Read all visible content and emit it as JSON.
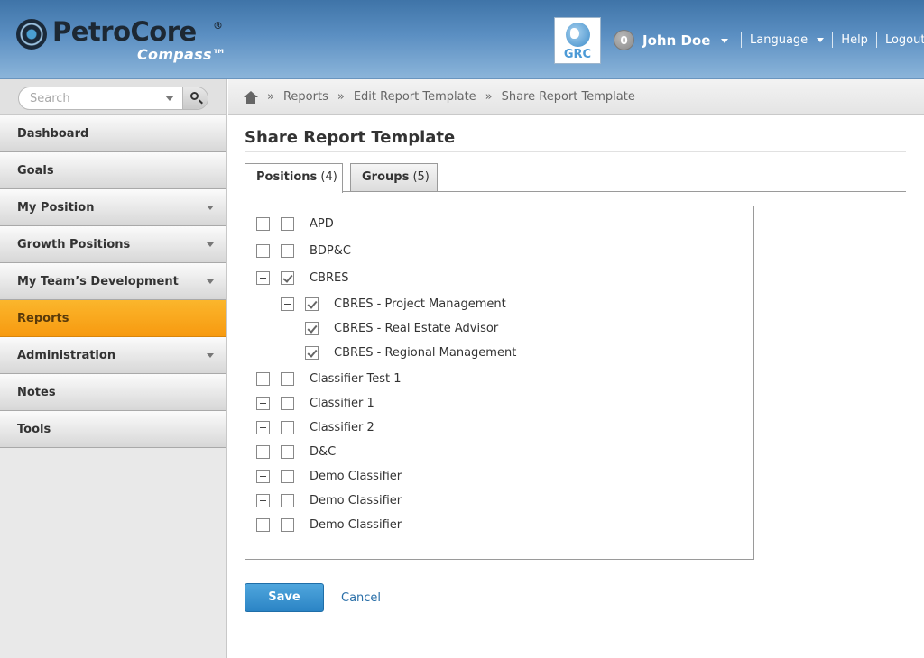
{
  "header": {
    "logo_name": "PetroCore",
    "logo_reg": "®",
    "logo_sub": "Compass™",
    "badge_label": "GRC",
    "notification_count": "0",
    "user_name": "John Doe",
    "language_label": "Language",
    "help_label": "Help",
    "logout_label": "Logout"
  },
  "sidebar": {
    "search_placeholder": "Search",
    "items": [
      {
        "label": "Dashboard",
        "has_caret": false
      },
      {
        "label": "Goals",
        "has_caret": false
      },
      {
        "label": "My Position",
        "has_caret": true
      },
      {
        "label": "Growth Positions",
        "has_caret": true
      },
      {
        "label": "My Team’s Development",
        "has_caret": true
      },
      {
        "label": "Reports",
        "has_caret": false,
        "active": true
      },
      {
        "label": "Administration",
        "has_caret": true
      },
      {
        "label": "Notes",
        "has_caret": false
      },
      {
        "label": "Tools",
        "has_caret": false
      }
    ]
  },
  "breadcrumb": {
    "items": [
      "Reports",
      "Edit Report Template",
      "Share Report Template"
    ],
    "separator": "»"
  },
  "main": {
    "title": "Share Report Template",
    "tabs": [
      {
        "label": "Positions",
        "count": "(4)",
        "active": true
      },
      {
        "label": "Groups",
        "count": "(5)",
        "active": false
      }
    ],
    "tree": [
      {
        "label": "APD",
        "expander": "plus",
        "checked": false,
        "level": 0
      },
      {
        "label": "BDP&C",
        "expander": "plus",
        "checked": false,
        "level": 0
      },
      {
        "label": "CBRES",
        "expander": "minus",
        "checked": true,
        "level": 0
      },
      {
        "label": "CBRES - Project Management",
        "expander": "minus",
        "checked": true,
        "level": 1
      },
      {
        "label": "CBRES - Real Estate Advisor",
        "expander": "none",
        "checked": true,
        "level": 1
      },
      {
        "label": "CBRES - Regional Management",
        "expander": "none",
        "checked": true,
        "level": 1
      },
      {
        "label": "Classifier Test 1",
        "expander": "plus",
        "checked": false,
        "level": 0
      },
      {
        "label": "Classifier 1",
        "expander": "plus",
        "checked": false,
        "level": 0
      },
      {
        "label": "Classifier 2",
        "expander": "plus",
        "checked": false,
        "level": 0
      },
      {
        "label": "D&C",
        "expander": "plus",
        "checked": false,
        "level": 0
      },
      {
        "label": "Demo Classifier",
        "expander": "plus",
        "checked": false,
        "level": 0
      },
      {
        "label": "Demo Classifier",
        "expander": "plus",
        "checked": false,
        "level": 0
      },
      {
        "label": "Demo Classifier",
        "expander": "plus",
        "checked": false,
        "level": 0
      }
    ],
    "save_label": "Save",
    "cancel_label": "Cancel"
  },
  "colors": {
    "accent": "#f79a10",
    "primary_button": "#2b84c5",
    "header": "#4a7fb3"
  }
}
